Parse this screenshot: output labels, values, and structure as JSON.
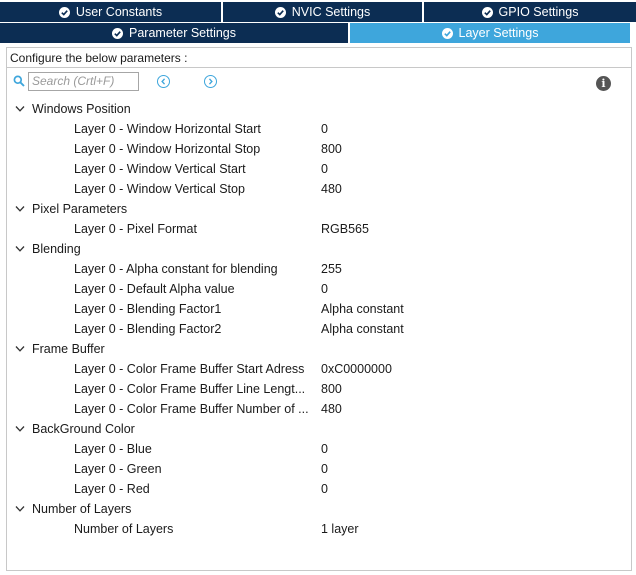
{
  "tabs": {
    "row1": [
      {
        "label": "User Constants",
        "active": false
      },
      {
        "label": "NVIC Settings",
        "active": false
      },
      {
        "label": "GPIO Settings",
        "active": false
      }
    ],
    "row2": [
      {
        "label": "Parameter Settings",
        "active": false
      },
      {
        "label": "Layer Settings",
        "active": true
      }
    ]
  },
  "panel": {
    "configure_text": "Configure the below parameters :",
    "search_placeholder": "Search (Crtl+F)"
  },
  "tree": [
    {
      "group": "Windows Position",
      "params": [
        {
          "name": "Layer 0 - Window Horizontal Start",
          "value": "0"
        },
        {
          "name": "Layer 0 - Window Horizontal Stop",
          "value": "800"
        },
        {
          "name": "Layer 0 - Window Vertical Start",
          "value": "0"
        },
        {
          "name": "Layer 0 - Window Vertical Stop",
          "value": "480"
        }
      ]
    },
    {
      "group": "Pixel Parameters",
      "params": [
        {
          "name": "Layer 0 - Pixel Format",
          "value": "RGB565"
        }
      ]
    },
    {
      "group": "Blending",
      "params": [
        {
          "name": "Layer 0 - Alpha constant for blending",
          "value": "255"
        },
        {
          "name": "Layer 0 - Default Alpha value",
          "value": "0"
        },
        {
          "name": "Layer 0 - Blending Factor1",
          "value": "Alpha constant"
        },
        {
          "name": "Layer 0 - Blending Factor2",
          "value": "Alpha constant"
        }
      ]
    },
    {
      "group": "Frame Buffer",
      "params": [
        {
          "name": "Layer 0 - Color Frame Buffer Start Adress",
          "value": "0xC0000000"
        },
        {
          "name": "Layer 0 - Color Frame Buffer Line Lengt...",
          "value": "800"
        },
        {
          "name": "Layer 0 - Color Frame Buffer Number of ...",
          "value": "480"
        }
      ]
    },
    {
      "group": "BackGround Color",
      "params": [
        {
          "name": "Layer 0 - Blue",
          "value": "0"
        },
        {
          "name": "Layer 0 - Green",
          "value": "0"
        },
        {
          "name": "Layer 0 - Red",
          "value": "0"
        }
      ]
    },
    {
      "group": "Number of Layers",
      "params": [
        {
          "name": "Number of Layers",
          "value": "1 layer"
        }
      ]
    }
  ],
  "colors": {
    "tab_dark": "#0c2d53",
    "tab_active": "#3ea6dc",
    "icon_gray": "#555555"
  },
  "icons": {
    "tab_status": "check-circle-icon",
    "search": "search-icon",
    "prev": "chevron-left-icon",
    "next": "chevron-right-icon",
    "info": "info-icon",
    "expand": "chevron-down-icon"
  }
}
